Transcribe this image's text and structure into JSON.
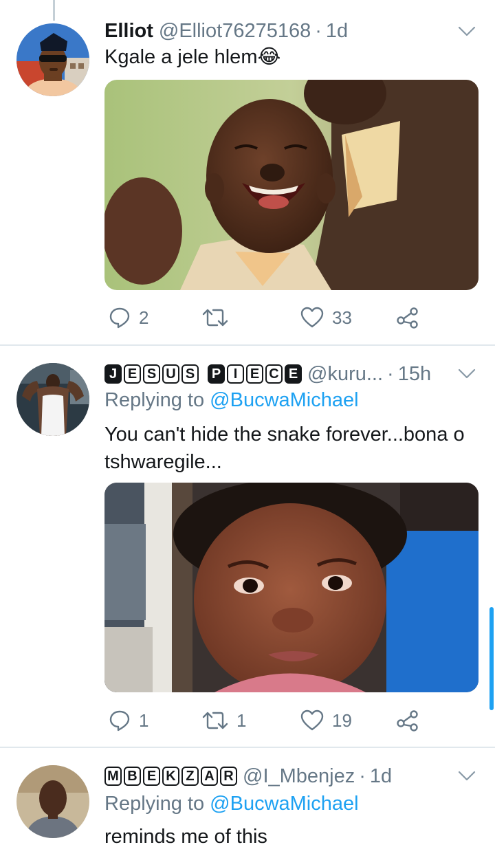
{
  "tweets": [
    {
      "name": "Elliot",
      "handle": "@Elliot76275168",
      "separator": "·",
      "time": "1d",
      "text": "Kgale a  jele hlem",
      "emoji": "😂",
      "emoji_icon": "face-with-tears-of-joy-icon",
      "media": "photo of a laughing child with missing front teeth",
      "actions": {
        "replies": "2",
        "retweets": "",
        "likes": "33"
      }
    },
    {
      "name_words": [
        [
          "J",
          "E",
          "S",
          "U",
          "S"
        ],
        [
          "P",
          "I",
          "E",
          "C",
          "E"
        ]
      ],
      "handle": "@kuru...",
      "separator": "·",
      "time": "15h",
      "replying_prefix": "Replying to",
      "replying_to": "@BucwaMichael",
      "text": "You can't hide the snake forever...bona o tshwaregile...",
      "media": "photo of a toddler girl with a suspicious face",
      "actions": {
        "replies": "1",
        "retweets": "1",
        "likes": "19"
      }
    },
    {
      "name_words": [
        [
          "M",
          "B",
          "E",
          "K",
          "Z",
          "A",
          "R"
        ]
      ],
      "handle": "@I_Mbenjez",
      "separator": "·",
      "time": "1d",
      "replying_prefix": "Replying to",
      "replying_to": "@BucwaMichael",
      "text": "reminds me of this"
    }
  ],
  "colors": {
    "accent": "#1da1f2",
    "text": "#14171a",
    "secondary": "#657786",
    "divider": "#e1e8ed"
  },
  "icons": [
    "reply-icon",
    "retweet-icon",
    "like-icon",
    "share-icon",
    "chevron-down-icon"
  ]
}
